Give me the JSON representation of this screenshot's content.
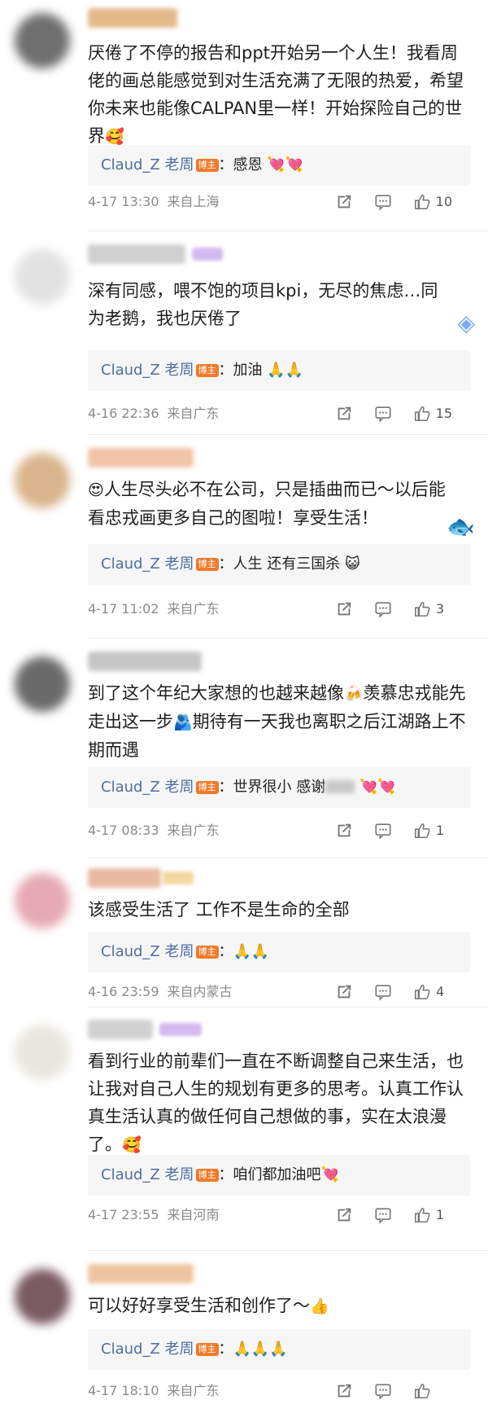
{
  "reply_author": "Claud_Z 老周",
  "blogger_badge": "博主",
  "comments": [
    {
      "text": "厌倦了不停的报告和ppt开始另一个人生！我看周佬的画总能感觉到对生活充满了无限的热爱，希望你未来也能像CALPAN里一样！开始探险自己的世界",
      "reply": "：感恩",
      "reply_emoji": "💘💘",
      "emoji_end": "🥰",
      "time": "4-17 13:30",
      "location": "来自上海",
      "likes": "10"
    },
    {
      "text": "深有同感，喂不饱的项目kpi，无尽的焦虑…同为老鹅，我也厌倦了",
      "reply": "：加油",
      "reply_emoji": "🙏🙏",
      "time": "4-16 22:36",
      "location": "来自广东",
      "likes": "15"
    },
    {
      "text": "人生尽头必不在公司，只是插曲而已～以后能看忠戎画更多自己的图啦！享受生活！",
      "emoji_start": "😍",
      "reply": "：人生  还有三国杀",
      "reply_emoji": "😺",
      "time": "4-17 11:02",
      "location": "来自广东",
      "likes": "3"
    },
    {
      "text_a": "到了这个年纪大家想的也越来越像",
      "text_b": "羡慕忠戎能先走出这一步",
      "text_c": "期待有一天我也离职之后江湖路上不期而遇",
      "reply": "：世界很小  感谢",
      "reply_emoji": "💘💘",
      "time": "4-17 08:33",
      "location": "来自广东",
      "likes": "1"
    },
    {
      "text": "该感受生活了  工作不是生命的全部",
      "reply": "：",
      "reply_emoji": "🙏🙏",
      "time": "4-16 23:59",
      "location": "来自内蒙古",
      "likes": "4"
    },
    {
      "text": "看到行业的前辈们一直在不断调整自己来生活，也让我对自己人生的规划有更多的思考。认真工作认真生活认真的做任何自己想做的事，实在太浪漫了。",
      "emoji_end": "🥰",
      "reply": "：咱们都加油吧",
      "reply_emoji": "💘",
      "time": "4-17 23:55",
      "location": "来自河南",
      "likes": "1"
    },
    {
      "text": "可以好好享受生活和创作了～",
      "emoji_end": "👍",
      "reply": "：",
      "reply_emoji": "🙏🙏🙏",
      "time": "4-17 18:10",
      "location": "来自广东",
      "likes": ""
    }
  ],
  "icons": {
    "share": "share-icon",
    "reply": "comment-icon",
    "like": "thumbs-up-icon"
  },
  "colors": {
    "reply_name": "#4d6fa3",
    "blogger_badge": "#f07a2a",
    "reply_bg": "#f6f6f6"
  }
}
